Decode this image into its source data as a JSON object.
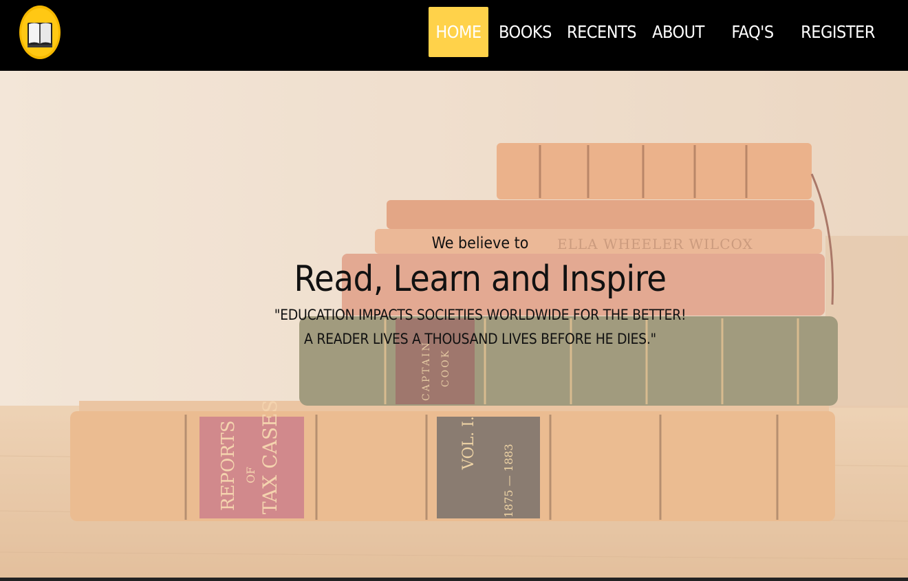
{
  "nav": {
    "items": [
      {
        "label": "HOME",
        "active": true
      },
      {
        "label": "BOOKS",
        "active": false
      },
      {
        "label": "RECENTS",
        "active": false
      },
      {
        "label": "ABOUT",
        "active": false
      },
      {
        "label": "FAQ'S",
        "active": false
      },
      {
        "label": "REGISTER",
        "active": false
      }
    ]
  },
  "hero": {
    "subtitle": "We believe to",
    "title": "Read, Learn and Inspire",
    "quote_line1": "\"EDUCATION IMPACTS SOCIETIES WORLDWIDE FOR THE BETTER!",
    "quote_line2": "A READER LIVES A THOUSAND LIVES BEFORE HE DIES.\"",
    "book_spine_texts": [
      "REPORTS",
      "OF",
      "TAX CASES",
      "VOL. I.",
      "1875 — 1883",
      "CAPTAIN",
      "COOK",
      "ELLA WHEELER WILCOX"
    ]
  },
  "colors": {
    "accent": "#ffd24a",
    "navbar_bg": "#000000",
    "nav_text": "#ffffff",
    "logo_circle": "#f5b800"
  },
  "icons": {
    "logo": "open-book-icon"
  }
}
